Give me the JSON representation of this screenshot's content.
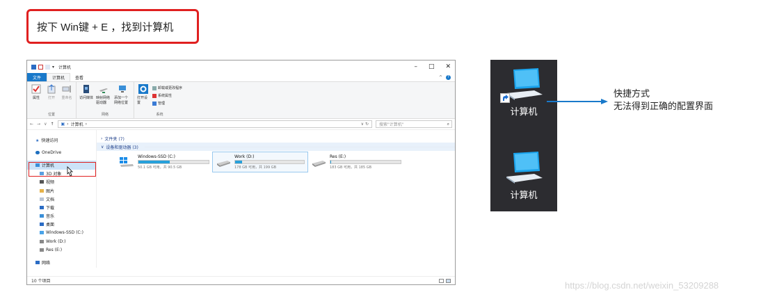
{
  "instruction": "按下 Win键 + E ，找到计算机",
  "explorer": {
    "title": "计算机",
    "tabs": {
      "file": "文件",
      "computer": "计算机",
      "view": "查看"
    },
    "ribbon": {
      "location_items": [
        "属性",
        "打开",
        "重命名"
      ],
      "location_label": "位置",
      "network_items": [
        "访问媒体",
        "映射网络驱动器",
        "添加一个网络位置"
      ],
      "network_label": "网络",
      "system_open": "打开设置",
      "system_small": [
        "卸载或更改程序",
        "系统属性",
        "管理"
      ],
      "system_label": "系统"
    },
    "address": {
      "path": "计算机",
      "search_placeholder": "搜索\"计算机\""
    },
    "nav": {
      "quick_access": "快速访问",
      "onedrive": "OneDrive",
      "computer": "计算机",
      "children": [
        "3D 对象",
        "视频",
        "图片",
        "文档",
        "下载",
        "音乐",
        "桌面",
        "Windows-SSD (C:)",
        "Work (D:)",
        "Res (E:)"
      ],
      "network": "网络"
    },
    "sections": {
      "folders": "文件夹 (7)",
      "drives": "设备和驱动器 (3)"
    },
    "drives": [
      {
        "name": "Windows-SSD (C:)",
        "free": "50.1 GB 可用，共 90.5 GB",
        "used_fraction": 0.45
      },
      {
        "name": "Work (D:)",
        "free": "178 GB 可用，共 199 GB",
        "used_fraction": 0.1
      },
      {
        "name": "Res (E:)",
        "free": "183 GB 可用，共 185 GB",
        "used_fraction": 0.01
      }
    ],
    "status": "10 个项目"
  },
  "desktop": {
    "icon_label_1": "计算机",
    "icon_label_2": "计算机"
  },
  "annotation": {
    "line1": "快捷方式",
    "line2": "无法得到正确的配置界面"
  },
  "watermark": "https://blog.csdn.net/weixin_53209288",
  "colors": {
    "highlight_red": "#e02020",
    "accent_blue": "#1979ca",
    "desktop_bg": "#2c2c30"
  }
}
